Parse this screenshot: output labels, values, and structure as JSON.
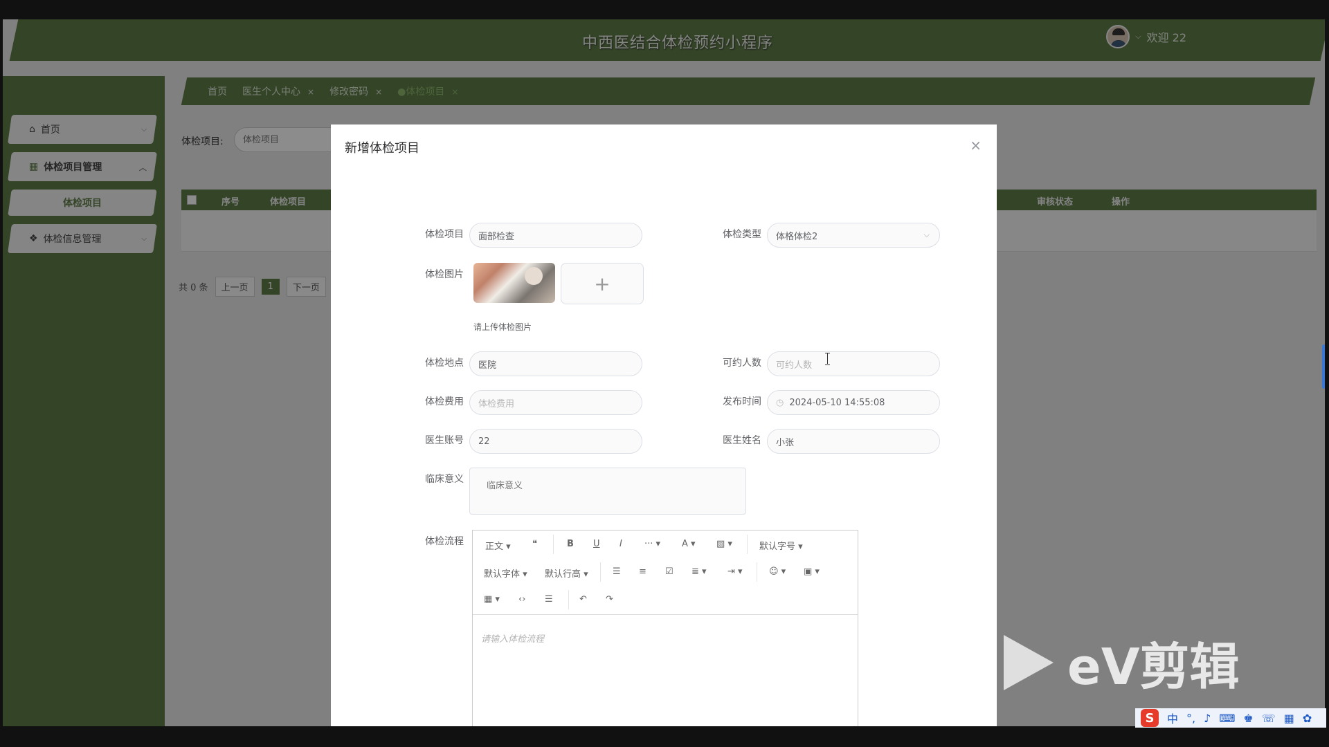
{
  "app": {
    "title": "中西医结合体检预约小程序",
    "welcome": "欢迎 22"
  },
  "sidebar": {
    "items": [
      {
        "label": "首页"
      },
      {
        "label": "体检项目管理"
      },
      {
        "label": "体检项目"
      },
      {
        "label": "体检信息管理"
      }
    ]
  },
  "tabs": [
    {
      "label": "首页"
    },
    {
      "label": "医生个人中心"
    },
    {
      "label": "修改密码"
    },
    {
      "label": "●体检项目"
    }
  ],
  "search": {
    "label": "体检项目:",
    "placeholder": "体检项目"
  },
  "table": {
    "headers": [
      "序号",
      "体检项目",
      "审核状态",
      "操作"
    ]
  },
  "pager": {
    "total": "共 0 条",
    "prev": "上一页",
    "page": "1",
    "next": "下一页"
  },
  "modal": {
    "title": "新增体检项目",
    "close": "×",
    "fields": {
      "name": {
        "label": "体检项目",
        "value": "面部检查"
      },
      "type": {
        "label": "体检类型",
        "value": "体格体检2"
      },
      "image": {
        "label": "体检图片",
        "hint": "请上传体检图片",
        "add": "+"
      },
      "location": {
        "label": "体检地点",
        "value": "医院"
      },
      "capacity": {
        "label": "可约人数",
        "placeholder": "可约人数"
      },
      "fee": {
        "label": "体检费用",
        "placeholder": "体检费用"
      },
      "publish_time": {
        "label": "发布时间",
        "value": "2024-05-10 14:55:08"
      },
      "doctor_account": {
        "label": "医生账号",
        "value": "22"
      },
      "doctor_name": {
        "label": "医生姓名",
        "value": "小张"
      },
      "clinical": {
        "label": "临床意义",
        "placeholder": "临床意义"
      },
      "process": {
        "label": "体检流程",
        "placeholder": "请输入体检流程"
      }
    },
    "editor": {
      "paragraph": "正文",
      "font_size": "默认字号",
      "font_family": "默认字体",
      "line_height": "默认行高"
    }
  },
  "watermark": {
    "text": "eV剪辑"
  },
  "tray": {
    "lang": "中"
  }
}
